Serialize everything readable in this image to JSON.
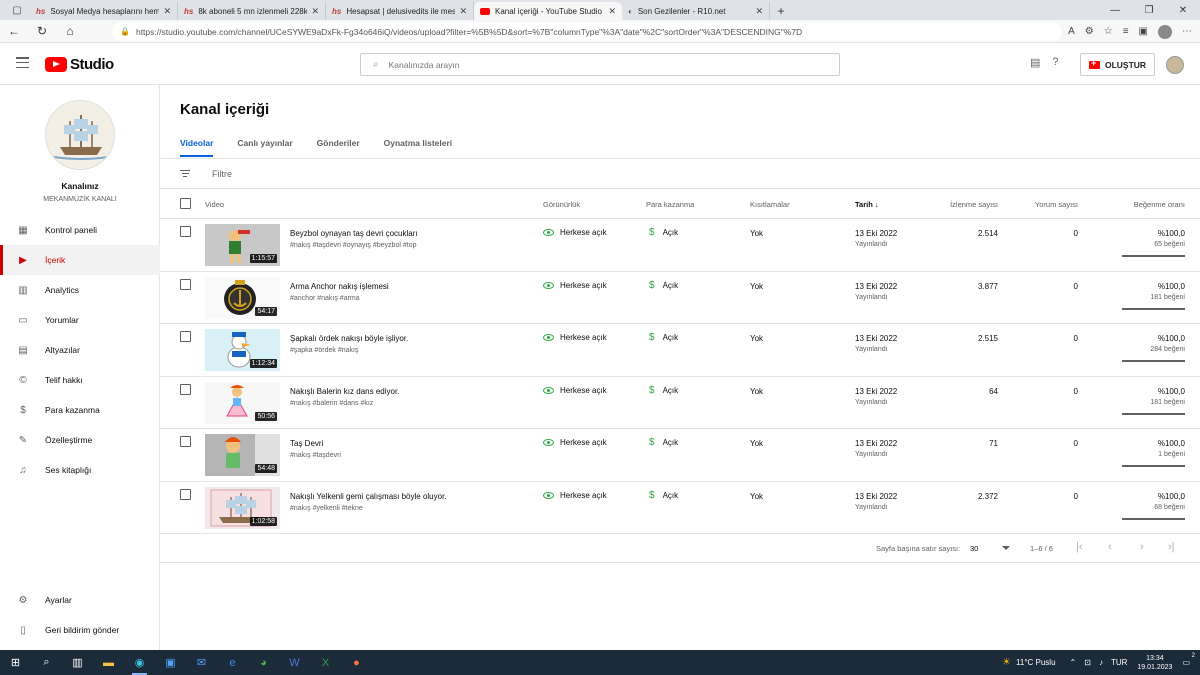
{
  "browser": {
    "tabs": [
      {
        "label": "Sosyal Medya hesaplarını hemen",
        "favicon": "hs"
      },
      {
        "label": "8k aboneli 5 mn izlenmeli 228k",
        "favicon": "hs"
      },
      {
        "label": "Hesapsat | delusivedits ile mesaj",
        "favicon": "hs"
      },
      {
        "label": "Kanal içeriği - YouTube Studio",
        "favicon": "yt",
        "active": true
      },
      {
        "label": "Son Gezilenler - R10.net",
        "favicon": "r10"
      }
    ],
    "url": "https://studio.youtube.com/channel/UCeSYWE9aDxFk-Fg34o646iQ/videos/upload?filter=%5B%5D&sort=%7B\"columnType\"%3A\"date\"%2C\"sortOrder\"%3A\"DESCENDING\"%7D"
  },
  "header": {
    "logo_text": "Studio",
    "search_placeholder": "Kanalınızda arayın",
    "create_label": "OLUŞTUR"
  },
  "channel": {
    "name": "Kanalınız",
    "subtitle": "MEKANMÜZİK KANALI"
  },
  "sidebar": {
    "items": [
      {
        "label": "Kontrol paneli",
        "icon": "dashboard-icon"
      },
      {
        "label": "İçerik",
        "icon": "content-icon",
        "active": true
      },
      {
        "label": "Analytics",
        "icon": "analytics-icon"
      },
      {
        "label": "Yorumlar",
        "icon": "comments-icon"
      },
      {
        "label": "Altyazılar",
        "icon": "subtitles-icon"
      },
      {
        "label": "Telif hakkı",
        "icon": "copyright-icon"
      },
      {
        "label": "Para kazanma",
        "icon": "monetization-icon"
      },
      {
        "label": "Özelleştirme",
        "icon": "customization-icon"
      },
      {
        "label": "Ses kitaplığı",
        "icon": "audio-library-icon"
      }
    ],
    "bottom": [
      {
        "label": "Ayarlar",
        "icon": "settings-icon"
      },
      {
        "label": "Geri bildirim gönder",
        "icon": "feedback-icon"
      }
    ]
  },
  "main": {
    "title": "Kanal içeriği",
    "tabs": [
      "Videolar",
      "Canlı yayınlar",
      "Gönderiler",
      "Oynatma listeleri"
    ],
    "filter_label": "Filtre",
    "columns": {
      "video": "Video",
      "visibility": "Görünürlük",
      "monetization": "Para kazanma",
      "restrictions": "Kısıtlamalar",
      "date": "Tarih",
      "views": "İzlenme sayısı",
      "comments": "Yorum sayısı",
      "likes": "Beğenme oranı"
    },
    "videos": [
      {
        "title": "Beyzbol oynayan taş devri çocukları",
        "tags": "#nakış #taşdevri #oynayış #beyzbol #top",
        "duration": "1:15:57",
        "visibility": "Herkese açık",
        "monetization": "Açık",
        "restrictions": "Yok",
        "date": "13 Eki 2022",
        "status": "Yayınlandı",
        "views": "2.514",
        "comments": "0",
        "like_ratio": "%100,0",
        "likes": "65 beğeni"
      },
      {
        "title": "Arma Anchor nakış işlemesi",
        "tags": "#anchor #nakış #arma",
        "duration": "54:17",
        "visibility": "Herkese açık",
        "monetization": "Açık",
        "restrictions": "Yok",
        "date": "13 Eki 2022",
        "status": "Yayınlandı",
        "views": "3.877",
        "comments": "0",
        "like_ratio": "%100,0",
        "likes": "181 beğeni"
      },
      {
        "title": "Şapkalı ördek nakışı böyle işliyor.",
        "tags": "#şapka #ördek #nakış",
        "duration": "1:12:34",
        "visibility": "Herkese açık",
        "monetization": "Açık",
        "restrictions": "Yok",
        "date": "13 Eki 2022",
        "status": "Yayınlandı",
        "views": "2.515",
        "comments": "0",
        "like_ratio": "%100,0",
        "likes": "284 beğeni"
      },
      {
        "title": "Nakışlı Balerin kız dans ediyor.",
        "tags": "#nakış #balerin #dans #kız",
        "duration": "50:56",
        "visibility": "Herkese açık",
        "monetization": "Açık",
        "restrictions": "Yok",
        "date": "13 Eki 2022",
        "status": "Yayınlandı",
        "views": "64",
        "comments": "0",
        "like_ratio": "%100,0",
        "likes": "181 beğeni"
      },
      {
        "title": "Taş Devri",
        "tags": "#nakış #taşdevri",
        "duration": "54:48",
        "visibility": "Herkese açık",
        "monetization": "Açık",
        "restrictions": "Yok",
        "date": "13 Eki 2022",
        "status": "Yayınlandı",
        "views": "71",
        "comments": "0",
        "like_ratio": "%100,0",
        "likes": "1 beğeni"
      },
      {
        "title": "Nakışlı Yelkenli gemi çalışması böyle oluyor.",
        "tags": "#nakış #yelkenli #tekne",
        "duration": "1:02:58",
        "visibility": "Herkese açık",
        "monetization": "Açık",
        "restrictions": "Yok",
        "date": "13 Eki 2022",
        "status": "Yayınlandı",
        "views": "2.372",
        "comments": "0",
        "like_ratio": "%100,0",
        "likes": "68 beğeni"
      }
    ],
    "pagination": {
      "rows_label": "Sayfa başına satır sayısı:",
      "rows_value": "30",
      "range": "1–6 / 6"
    }
  },
  "taskbar": {
    "weather": "11°C  Puslu",
    "language": "TUR",
    "time": "13:34",
    "date": "19.01.2023",
    "notification_count": "2"
  }
}
